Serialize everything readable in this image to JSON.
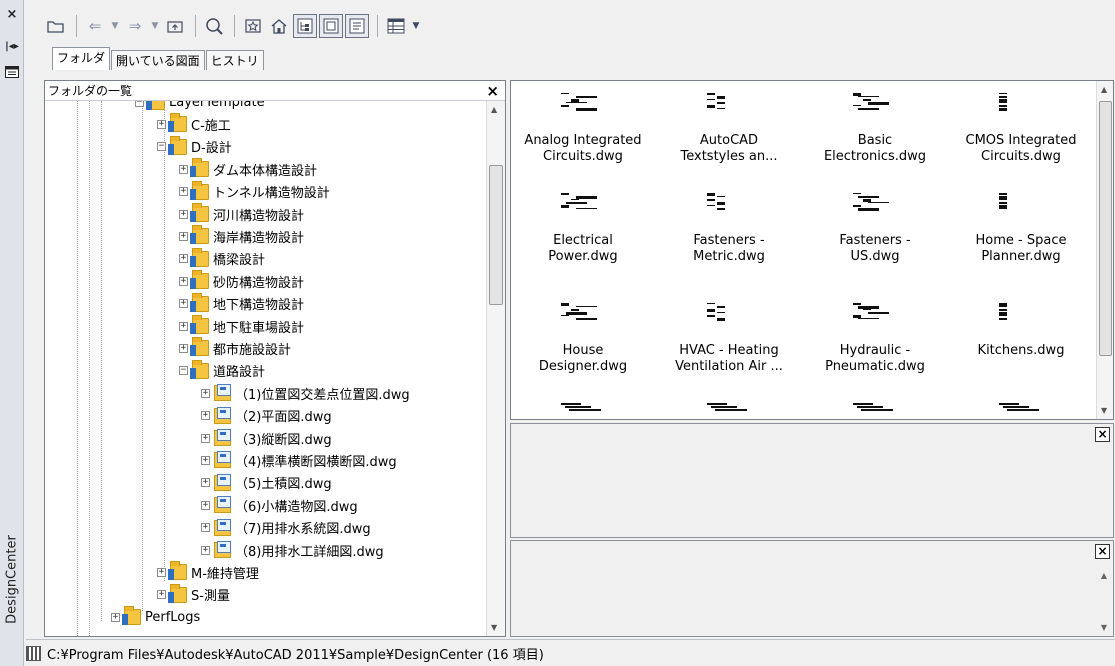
{
  "panel_title": "DesignCenter",
  "tabs": [
    "フォルダ",
    "開いている図面",
    "ヒストリ"
  ],
  "folder_pane": {
    "title": "フォルダの一覧",
    "tree": [
      {
        "label": "LayerTemplate",
        "level": 2,
        "type": "folder",
        "expander": "−"
      },
      {
        "label": "C-施工",
        "level": 3,
        "type": "folder",
        "expander": "+"
      },
      {
        "label": "D-設計",
        "level": 3,
        "type": "folder",
        "expander": "−"
      },
      {
        "label": "ダム本体構造設計",
        "level": 4,
        "type": "folder",
        "expander": "+"
      },
      {
        "label": "トンネル構造物設計",
        "level": 4,
        "type": "folder",
        "expander": "+"
      },
      {
        "label": "河川構造物設計",
        "level": 4,
        "type": "folder",
        "expander": "+"
      },
      {
        "label": "海岸構造物設計",
        "level": 4,
        "type": "folder",
        "expander": "+"
      },
      {
        "label": "橋梁設計",
        "level": 4,
        "type": "folder",
        "expander": "+"
      },
      {
        "label": "砂防構造物設計",
        "level": 4,
        "type": "folder",
        "expander": "+"
      },
      {
        "label": "地下構造物設計",
        "level": 4,
        "type": "folder",
        "expander": "+"
      },
      {
        "label": "地下駐車場設計",
        "level": 4,
        "type": "folder",
        "expander": "+"
      },
      {
        "label": "都市施設設計",
        "level": 4,
        "type": "folder",
        "expander": "+"
      },
      {
        "label": "道路設計",
        "level": 4,
        "type": "folder",
        "expander": "−"
      },
      {
        "label": "（1)位置図交差点位置図.dwg",
        "level": 5,
        "type": "dwg",
        "expander": "+"
      },
      {
        "label": "（2)平面図.dwg",
        "level": 5,
        "type": "dwg",
        "expander": "+"
      },
      {
        "label": "（3)縦断図.dwg",
        "level": 5,
        "type": "dwg",
        "expander": "+"
      },
      {
        "label": "（4)標準横断図横断図.dwg",
        "level": 5,
        "type": "dwg",
        "expander": "+"
      },
      {
        "label": "（5)土積図.dwg",
        "level": 5,
        "type": "dwg",
        "expander": "+"
      },
      {
        "label": "（6)小構造物図.dwg",
        "level": 5,
        "type": "dwg",
        "expander": "+"
      },
      {
        "label": "（7)用排水系統図.dwg",
        "level": 5,
        "type": "dwg",
        "expander": "+"
      },
      {
        "label": "（8)用排水工詳細図.dwg",
        "level": 5,
        "type": "dwg",
        "expander": "+"
      },
      {
        "label": "M-維持管理",
        "level": 3,
        "type": "folder",
        "expander": "+"
      },
      {
        "label": "S-測量",
        "level": 3,
        "type": "folder",
        "expander": "+"
      },
      {
        "label": "PerfLogs",
        "level": 1,
        "type": "folder",
        "expander": "+"
      }
    ]
  },
  "content_pane": {
    "items": [
      {
        "line1": "Analog Integrated",
        "line2": "Circuits.dwg"
      },
      {
        "line1": "AutoCAD",
        "line2": "Textstyles an..."
      },
      {
        "line1": "Basic",
        "line2": "Electronics.dwg"
      },
      {
        "line1": "CMOS Integrated",
        "line2": "Circuits.dwg"
      },
      {
        "line1": "Electrical",
        "line2": "Power.dwg"
      },
      {
        "line1": "Fasteners -",
        "line2": "Metric.dwg"
      },
      {
        "line1": "Fasteners -",
        "line2": "US.dwg"
      },
      {
        "line1": "Home - Space",
        "line2": "Planner.dwg"
      },
      {
        "line1": "House",
        "line2": "Designer.dwg"
      },
      {
        "line1": "HVAC - Heating",
        "line2": "Ventilation Air ..."
      },
      {
        "line1": "Hydraulic -",
        "line2": "Pneumatic.dwg"
      },
      {
        "line1": "Kitchens.dwg",
        "line2": ""
      }
    ]
  },
  "status_text": "C:¥Program Files¥Autodesk¥AutoCAD 2011¥Sample¥DesignCenter (16 項目)",
  "icons": {
    "close": "×",
    "toolbar": [
      "load-icon",
      "back-icon",
      "dropdown-icon",
      "forward-icon",
      "dropdown-icon",
      "up-folder-icon",
      "search-icon",
      "favorites-icon",
      "home-icon",
      "tree-view-toggle-icon",
      "preview-toggle-icon",
      "description-toggle-icon",
      "views-icon",
      "views-dropdown-icon"
    ]
  }
}
